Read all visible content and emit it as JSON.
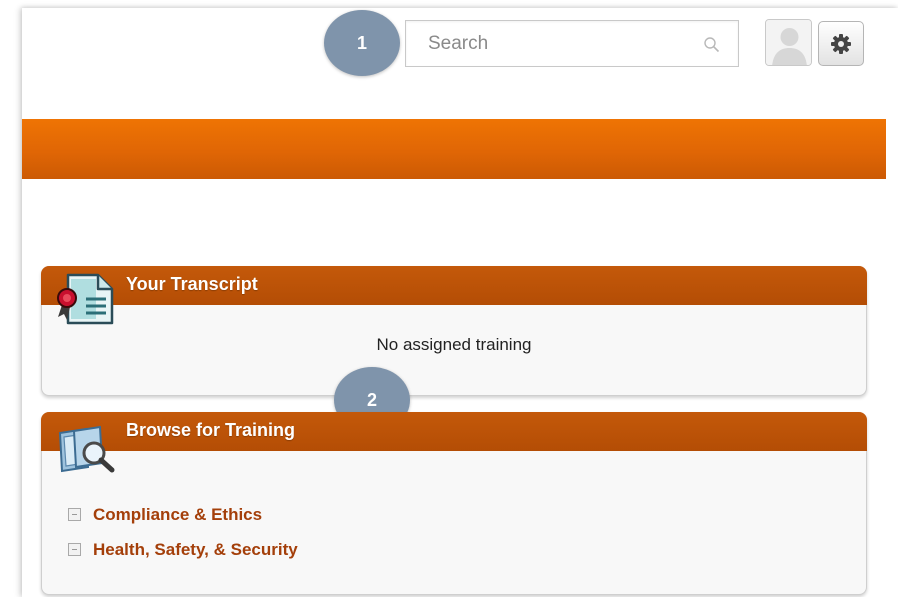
{
  "header": {
    "search": {
      "placeholder": "Search",
      "value": ""
    },
    "callout_1": "1"
  },
  "transcript": {
    "title": "Your Transcript",
    "empty_message": "No assigned training"
  },
  "callout_2": "2",
  "browse": {
    "title": "Browse for Training",
    "categories": [
      {
        "label": "Compliance & Ethics"
      },
      {
        "label": "Health, Safety, & Security"
      }
    ]
  },
  "colors": {
    "banner": "#e06605",
    "panel_header": "#bc5208",
    "link": "#a43f0a",
    "callout": "#7f94ab"
  },
  "icons": {
    "search": "search-icon",
    "settings": "gear-icon",
    "avatar": "user-avatar",
    "transcript": "certificate-document-icon",
    "browse": "catalog-search-icon"
  }
}
